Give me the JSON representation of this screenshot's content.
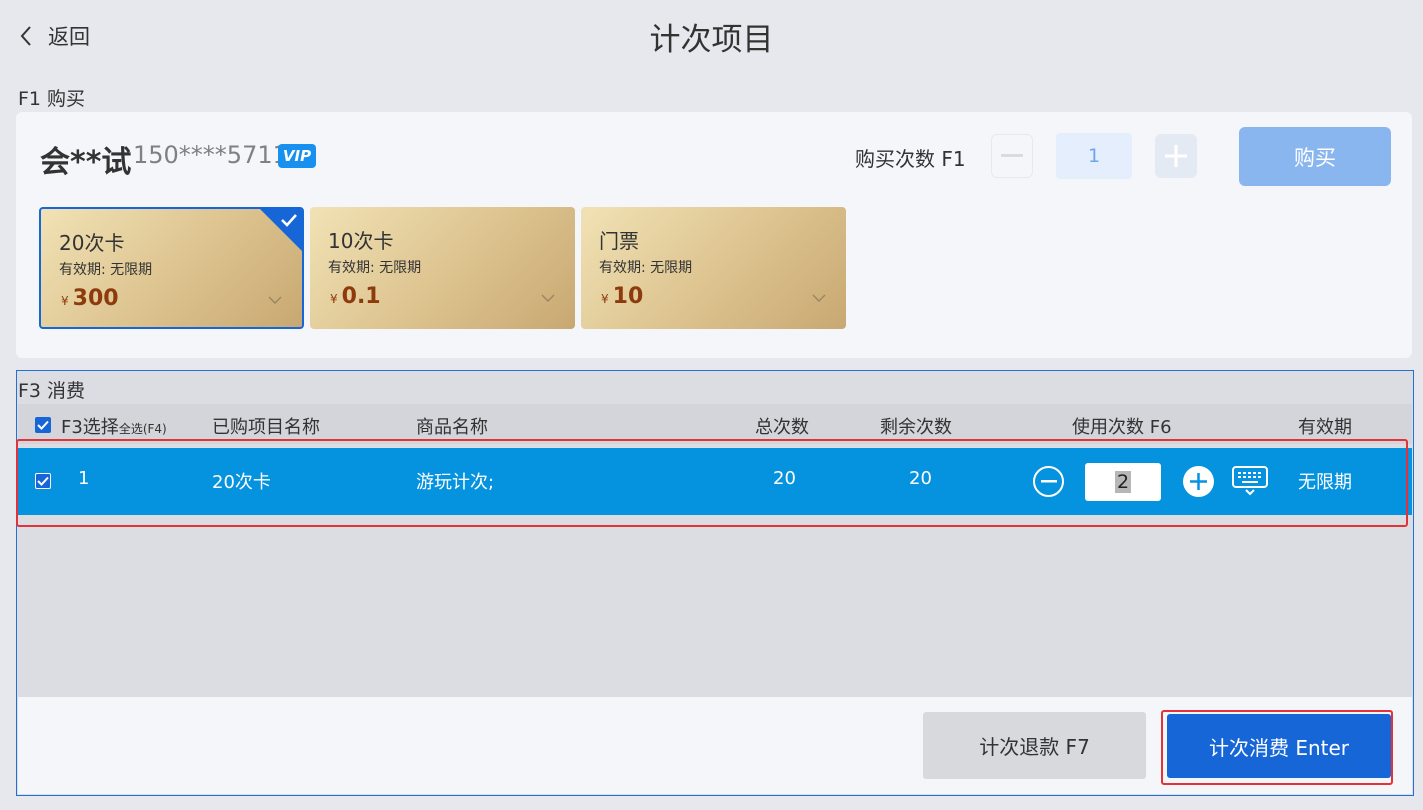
{
  "header": {
    "back_label": "返回",
    "title": "计次项目"
  },
  "purchase": {
    "section_label": "F1 购买",
    "member": {
      "name": "会**试",
      "phone": "150****5711",
      "badge": "VIP"
    },
    "count_label": "购买次数 F1",
    "count_value": "1",
    "buy_label": "购买",
    "cards": [
      {
        "name": "20次卡",
        "validity": "有效期: 无限期",
        "currency": "¥",
        "price": "300",
        "selected": true
      },
      {
        "name": "10次卡",
        "validity": "有效期: 无限期",
        "currency": "¥",
        "price": "0.1",
        "selected": false
      },
      {
        "name": "门票",
        "validity": "有效期: 无限期",
        "currency": "¥",
        "price": "10",
        "selected": false
      }
    ]
  },
  "consume": {
    "section_label": "F3 消费",
    "columns": {
      "select": "F3选择",
      "select_all": "全选(F4)",
      "project_name": "已购项目名称",
      "product_name": "商品名称",
      "total": "总次数",
      "remaining": "剩余次数",
      "use_count": "使用次数 F6",
      "validity": "有效期"
    },
    "rows": [
      {
        "index": "1",
        "project_name": "20次卡",
        "product_name": "游玩计次;",
        "total": "20",
        "remaining": "20",
        "use_count": "2",
        "validity": "无限期",
        "checked": true
      }
    ],
    "refund_label": "计次退款 F7",
    "consume_label": "计次消费 Enter"
  },
  "colors": {
    "accent": "#1766d8",
    "row_highlight": "#0592df",
    "highlight_frame": "#e0333a",
    "card_gold": "#dcc28e"
  }
}
